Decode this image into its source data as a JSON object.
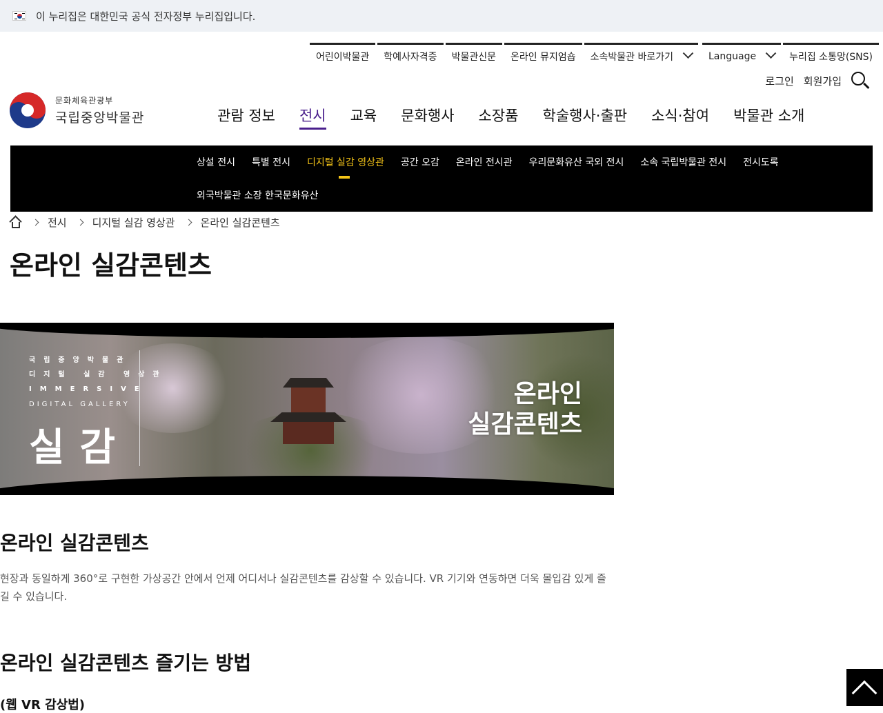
{
  "gov_banner": {
    "text": "이 누리집은 대한민국 공식 전자정부 누리집입니다."
  },
  "utility": {
    "items": [
      "어린이박물관",
      "학예사자격증",
      "박물관신문",
      "온라인 뮤지엄숍",
      "소속박물관 바로가기"
    ],
    "language": "Language",
    "sns": "누리집 소통망(SNS)",
    "login": "로그인",
    "signup": "회원가입"
  },
  "logo": {
    "sub": "문화체육관광부",
    "main": "국립중앙박물관"
  },
  "main_nav": [
    "관람 정보",
    "전시",
    "교육",
    "문화행사",
    "소장품",
    "학술행사·출판",
    "소식·참여",
    "박물관 소개"
  ],
  "sub_nav": {
    "row1": [
      "상설 전시",
      "특별 전시",
      "디지털 실감 영상관",
      "공간 오감",
      "온라인 전시관",
      "우리문화유산 국외 전시",
      "소속 국립박물관 전시",
      "전시도록"
    ],
    "row2": [
      "외국박물관 소장 한국문화유산"
    ]
  },
  "breadcrumb": [
    "전시",
    "디지털 실감 영상관",
    "온라인 실감콘텐츠"
  ],
  "page_title": "온라인 실감콘텐츠",
  "hero": {
    "line1": "국립중앙박물관",
    "line2": "디지털 실감 영상관",
    "line3": "IMMERSIVE",
    "line4": "DIGITAL GALLERY",
    "big": "실감",
    "right1": "온라인",
    "right2": "실감콘텐츠"
  },
  "section1": {
    "title": "온라인 실감콘텐츠",
    "desc": "현장과 동일하게 360°로 구현한 가상공간 안에서 언제 어디서나 실감콘텐츠를 감상할 수 있습니다. VR 기기와 연동하면 더욱 몰입감 있게 즐길 수 있습니다."
  },
  "section2": {
    "title": "온라인 실감콘텐츠 즐기는 방법",
    "sub": "(웹 VR 감상법)"
  },
  "colors": {
    "accent": "#4a1f8c",
    "sub_active": "#f5c518"
  }
}
